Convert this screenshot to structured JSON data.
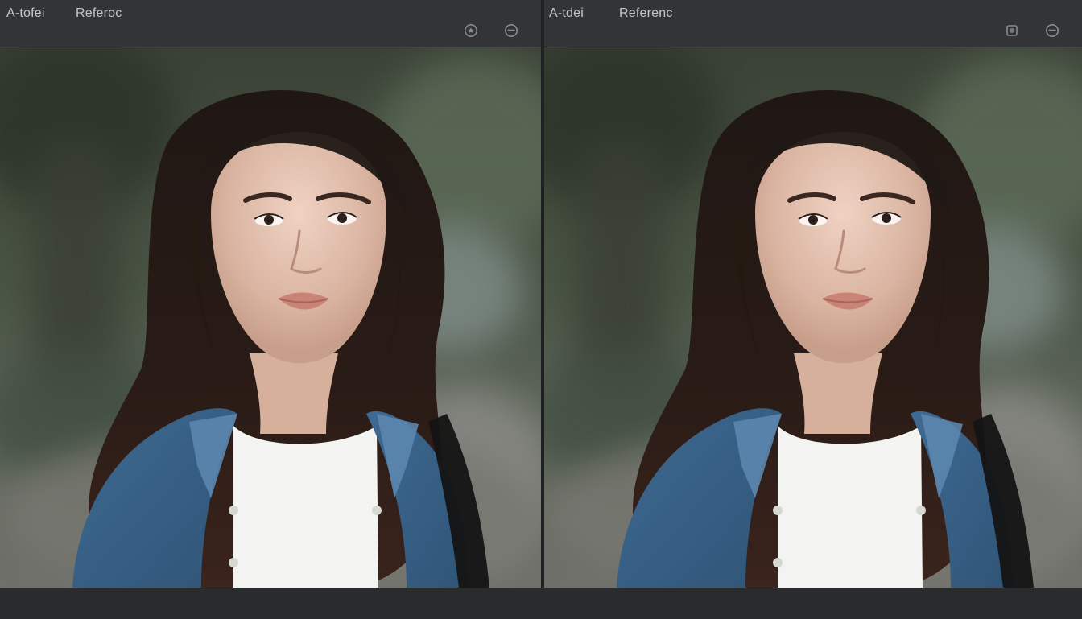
{
  "left_pane": {
    "tabs": [
      {
        "label": "A-tofei"
      },
      {
        "label": "Referoc"
      }
    ],
    "icons": [
      "star-circle-icon",
      "minus-circle-icon"
    ]
  },
  "right_pane": {
    "tabs": [
      {
        "label": "A-tdei"
      },
      {
        "label": "Referenc"
      }
    ],
    "icons": [
      "square-icon",
      "minus-circle-icon"
    ]
  },
  "colors": {
    "chrome": "#333436",
    "background": "#2b2c2e",
    "text": "#c6c7ca",
    "icon": "#8a8b8e"
  }
}
